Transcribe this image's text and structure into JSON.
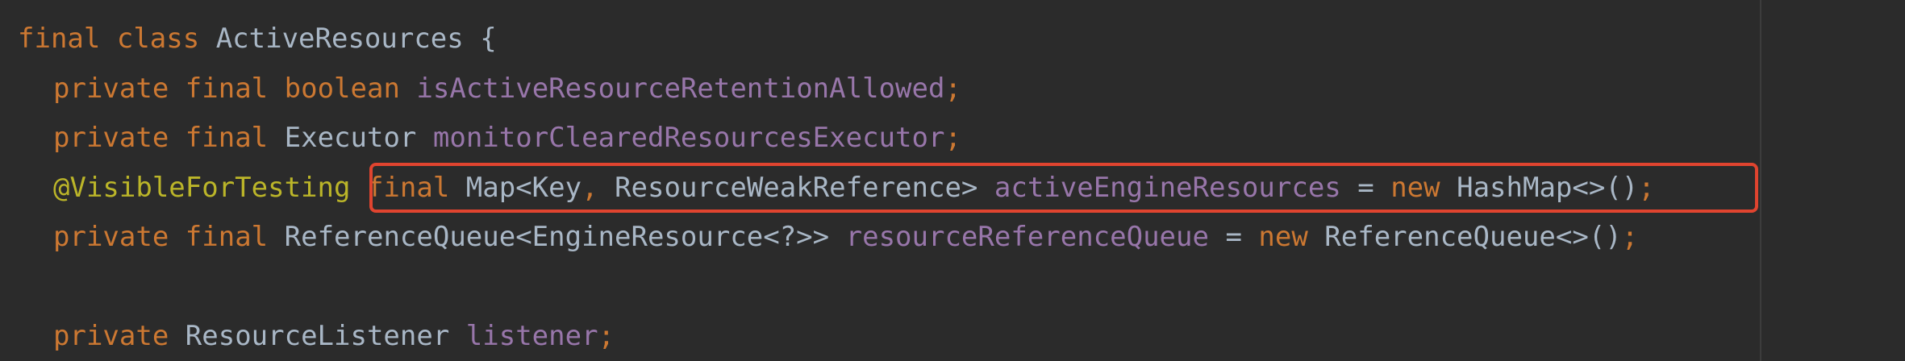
{
  "editor": {
    "lines": [
      {
        "tokens": [
          {
            "t": "final",
            "c": "kw"
          },
          {
            "t": " "
          },
          {
            "t": "class",
            "c": "kw"
          },
          {
            "t": " "
          },
          {
            "t": "ActiveResources",
            "c": "ty"
          },
          {
            "t": " {",
            "c": "plain"
          }
        ]
      },
      {
        "tokens": [
          {
            "t": "private",
            "c": "kw"
          },
          {
            "t": " "
          },
          {
            "t": "final",
            "c": "kw"
          },
          {
            "t": " "
          },
          {
            "t": "boolean",
            "c": "kw"
          },
          {
            "t": " "
          },
          {
            "t": "isActiveResourceRetentionAllowed",
            "c": "fld"
          },
          {
            "t": ";",
            "c": "punc"
          }
        ]
      },
      {
        "tokens": [
          {
            "t": "private",
            "c": "kw"
          },
          {
            "t": " "
          },
          {
            "t": "final",
            "c": "kw"
          },
          {
            "t": " "
          },
          {
            "t": "Executor",
            "c": "ty"
          },
          {
            "t": " "
          },
          {
            "t": "monitorClearedResourcesExecutor",
            "c": "fld"
          },
          {
            "t": ";",
            "c": "punc"
          }
        ]
      },
      {
        "tokens": [
          {
            "t": "@VisibleForTesting",
            "c": "ann"
          },
          {
            "t": " "
          },
          {
            "t": "final",
            "c": "kw"
          },
          {
            "t": " "
          },
          {
            "t": "Map<Key",
            "c": "ty"
          },
          {
            "t": ",",
            "c": "punc"
          },
          {
            "t": " "
          },
          {
            "t": "ResourceWeakReference>",
            "c": "ty"
          },
          {
            "t": " "
          },
          {
            "t": "activeEngineResources",
            "c": "fld"
          },
          {
            "t": " = ",
            "c": "plain"
          },
          {
            "t": "new",
            "c": "kw"
          },
          {
            "t": " "
          },
          {
            "t": "HashMap<>()",
            "c": "ty"
          },
          {
            "t": ";",
            "c": "punc"
          }
        ]
      },
      {
        "tokens": [
          {
            "t": "private",
            "c": "kw"
          },
          {
            "t": " "
          },
          {
            "t": "final",
            "c": "kw"
          },
          {
            "t": " "
          },
          {
            "t": "ReferenceQueue<EngineResource<?>>",
            "c": "ty"
          },
          {
            "t": " "
          },
          {
            "t": "resourceReferenceQueue",
            "c": "fld"
          },
          {
            "t": " = ",
            "c": "plain"
          },
          {
            "t": "new",
            "c": "kw"
          },
          {
            "t": " "
          },
          {
            "t": "ReferenceQueue<>()",
            "c": "ty"
          },
          {
            "t": ";",
            "c": "punc"
          }
        ]
      },
      {
        "tokens": []
      },
      {
        "tokens": [
          {
            "t": "private",
            "c": "kw"
          },
          {
            "t": " "
          },
          {
            "t": "ResourceListener",
            "c": "ty"
          },
          {
            "t": " "
          },
          {
            "t": "listener",
            "c": "fld"
          },
          {
            "t": ";",
            "c": "punc"
          }
        ]
      }
    ]
  },
  "colors": {
    "background": "#2b2b2b",
    "keyword": "#cc7832",
    "field": "#9876aa",
    "annotation": "#bbb529",
    "plain": "#a9b7c6",
    "highlight": "#e0442f"
  }
}
